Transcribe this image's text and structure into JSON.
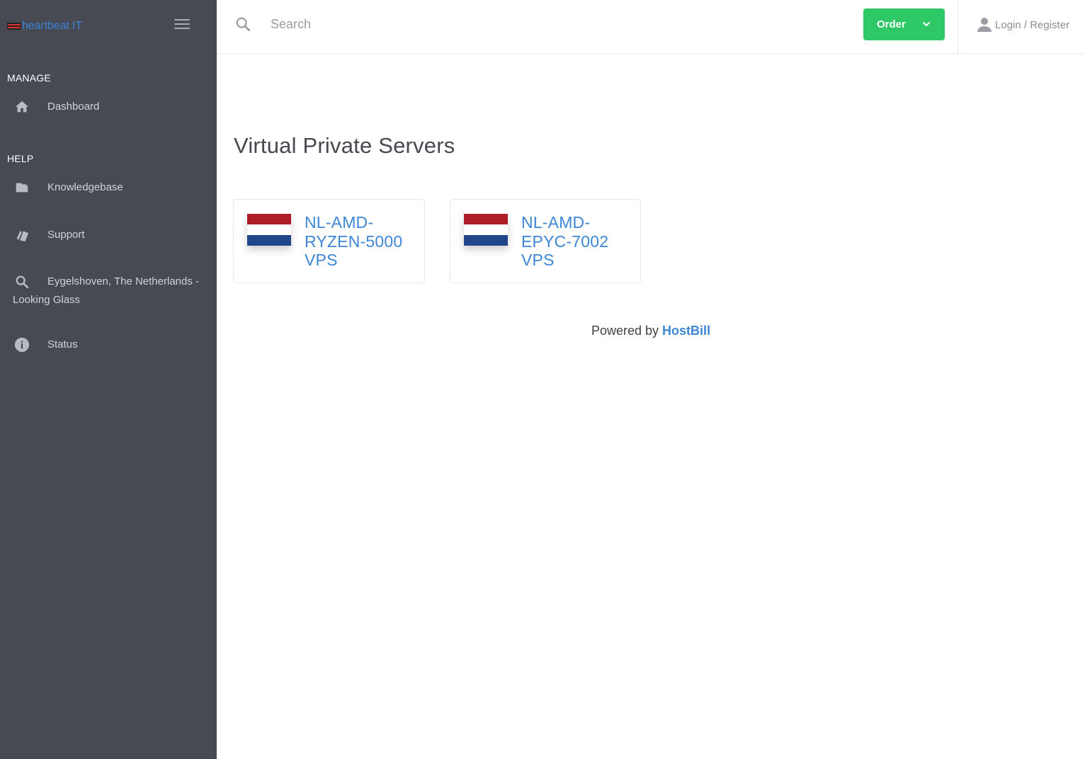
{
  "brand": {
    "name": "heartbeat IT",
    "color": "#3b82d8"
  },
  "sidebar": {
    "sections": [
      {
        "title": "MANAGE"
      },
      {
        "title": "HELP"
      }
    ],
    "items": [
      {
        "label": "Dashboard",
        "icon": "home-icon"
      },
      {
        "label": "Knowledgebase",
        "icon": "folder-icon"
      },
      {
        "label": "Support",
        "icon": "tickets-icon"
      },
      {
        "label": "Eygelshoven, The Netherlands - Looking Glass",
        "icon": "search-icon"
      },
      {
        "label": "Status",
        "icon": "info-icon"
      }
    ],
    "background": "#474a53"
  },
  "header": {
    "search_placeholder": "Search",
    "order_label": "Order",
    "order_color": "#2ec866",
    "login_label": "Login / Register"
  },
  "main": {
    "title": "Virtual Private Servers",
    "products": [
      {
        "name": "NL-AMD-RYZEN-5000 VPS",
        "flag": "netherlands-flag"
      },
      {
        "name": "NL-AMD-EPYC-7002 VPS",
        "flag": "netherlands-flag"
      }
    ],
    "footer_prefix": "Powered by",
    "footer_link": "HostBill",
    "link_color": "#3d87d6"
  }
}
